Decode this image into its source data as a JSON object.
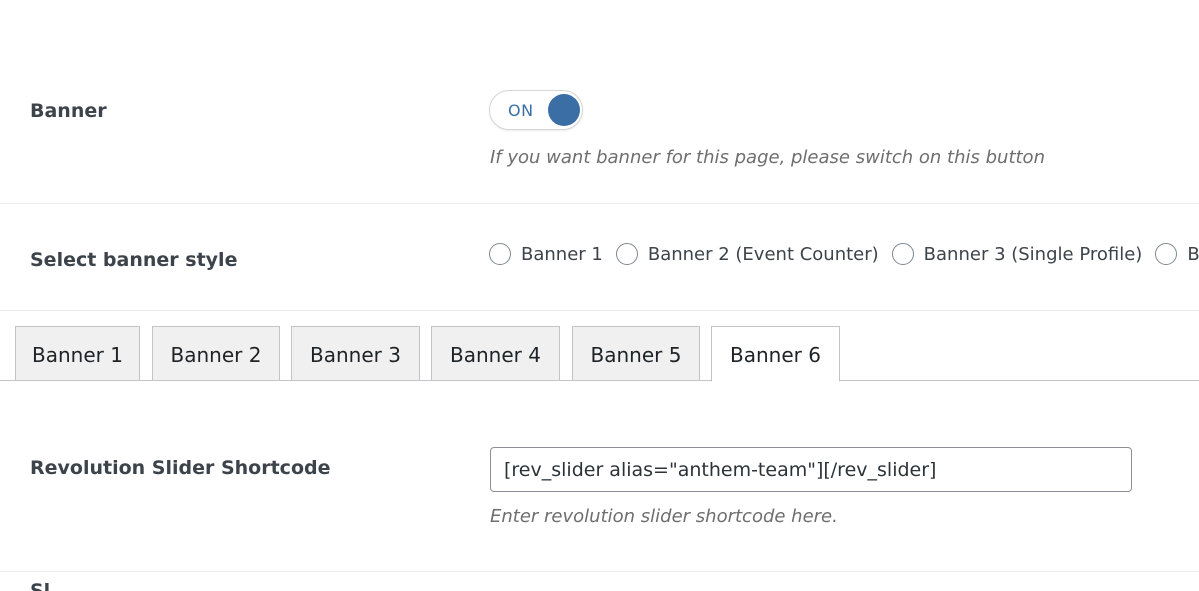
{
  "banner_row": {
    "label": "Banner",
    "toggle_text": "ON",
    "description": "If you want banner for this page, please switch on this button"
  },
  "style_row": {
    "label": "Select banner style",
    "options": [
      {
        "label": "Banner 1"
      },
      {
        "label": "Banner 2 (Event Counter)"
      },
      {
        "label": "Banner 3 (Single Profile)"
      },
      {
        "label": "Ban"
      }
    ]
  },
  "tabs": [
    {
      "label": "Banner 1"
    },
    {
      "label": "Banner 2"
    },
    {
      "label": "Banner 3"
    },
    {
      "label": "Banner 4"
    },
    {
      "label": "Banner 5"
    },
    {
      "label": "Banner 6"
    }
  ],
  "active_tab": "Banner 6",
  "shortcode_row": {
    "label": "Revolution Slider Shortcode",
    "value": "[rev_slider alias=\"anthem-team\"][/rev_slider]",
    "description": "Enter revolution slider shortcode here."
  },
  "next_row": {
    "label": "Sl"
  },
  "colors": {
    "accent": "#3a6ea5",
    "tab_bg": "#f0f0f1",
    "border": "#c3c4c7"
  }
}
